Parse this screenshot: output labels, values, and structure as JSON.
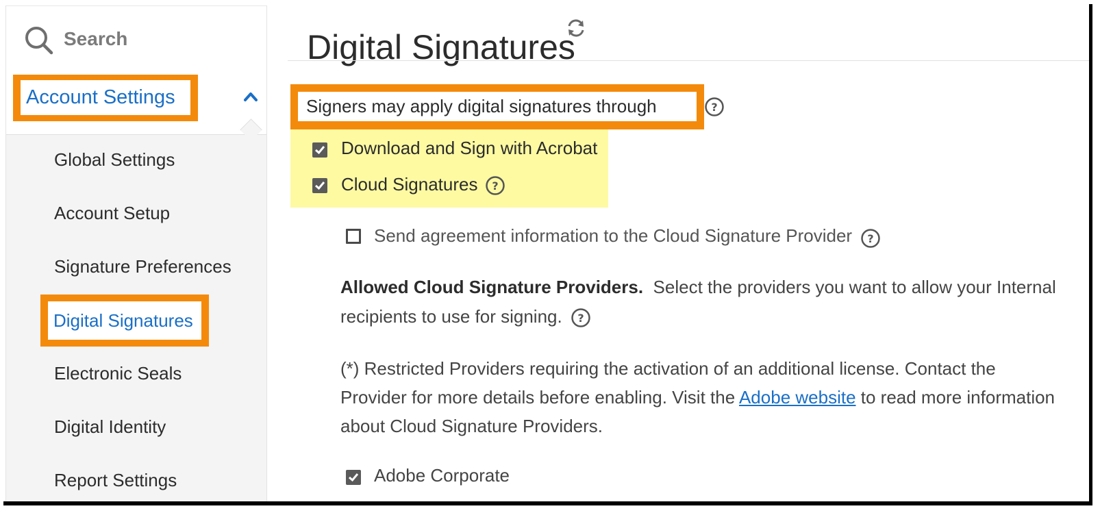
{
  "sidebar": {
    "search_placeholder": "Search",
    "section_title": "Account Settings",
    "items": [
      {
        "label": "Global Settings"
      },
      {
        "label": "Account Setup"
      },
      {
        "label": "Signature Preferences"
      },
      {
        "label": "Digital Signatures",
        "selected": true
      },
      {
        "label": "Electronic Seals"
      },
      {
        "label": "Digital Identity"
      },
      {
        "label": "Report Settings"
      }
    ]
  },
  "main": {
    "title": "Digital Signatures",
    "signers_heading": "Signers may apply digital signatures through",
    "options": [
      {
        "label": "Download and Sign with Acrobat",
        "checked": true
      },
      {
        "label": "Cloud Signatures",
        "checked": true
      }
    ],
    "send_info": {
      "label": "Send agreement information to the Cloud Signature Provider",
      "checked": false
    },
    "allowed": {
      "bold": "Allowed Cloud Signature Providers.",
      "text": "Select the providers you want to allow your Internal recipients to use for signing."
    },
    "restricted": {
      "before": "(*) Restricted Providers requiring the activation of an additional license. Contact the Provider for more details before enabling. Visit the",
      "link": "Adobe website",
      "after": "to read more information about Cloud Signature Providers."
    },
    "providers": [
      {
        "label": "Adobe Corporate",
        "checked": true
      }
    ]
  },
  "colors": {
    "highlight_orange": "#f48a0b",
    "highlight_yellow": "#fdfaa2",
    "link_blue": "#1a6fc7"
  },
  "icons": [
    "search-icon",
    "chevron-up-icon",
    "refresh-icon",
    "help-icon",
    "checkbox-checked",
    "checkbox-unchecked"
  ]
}
